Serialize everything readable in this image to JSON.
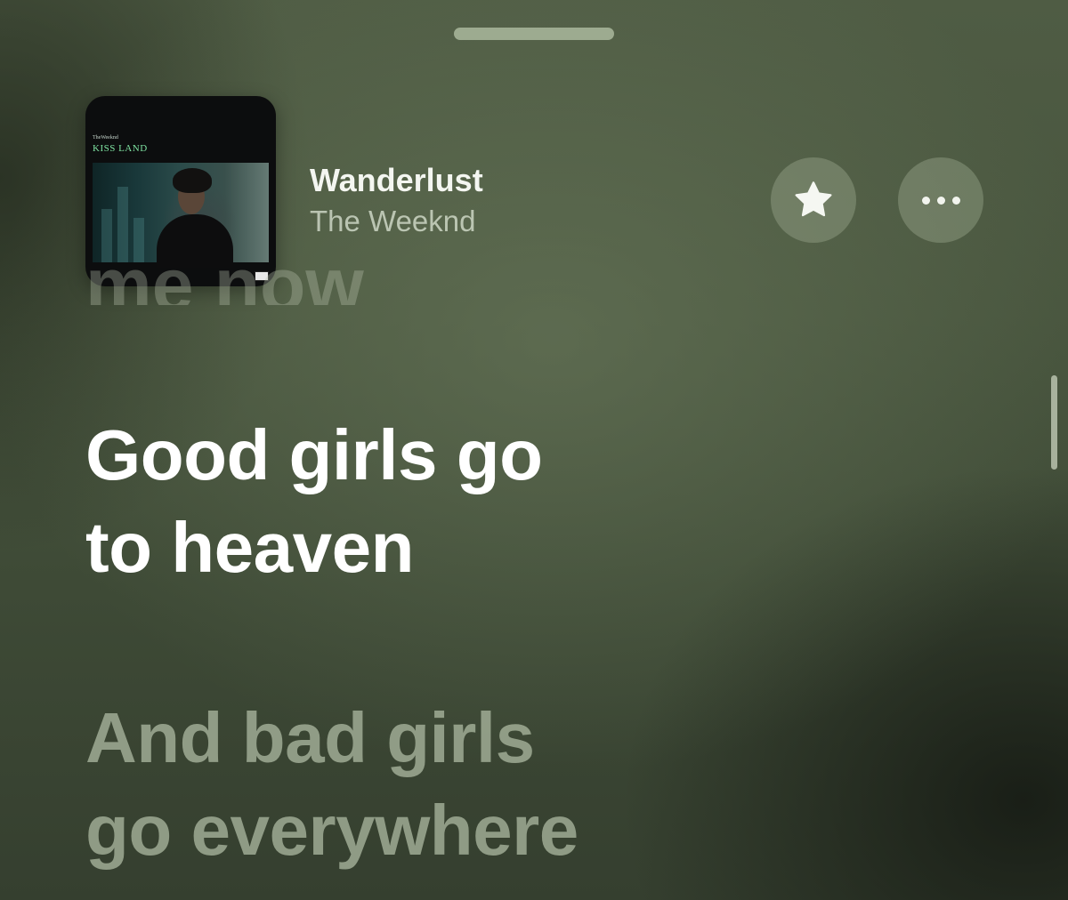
{
  "now_playing": {
    "album_art": {
      "brand_text": "TheWeeknd",
      "album_title": "KISS LAND",
      "title_color": "#7fe3a2"
    },
    "title": "Wanderlust",
    "artist": "The Weeknd",
    "favorite_icon": "star-icon",
    "more_icon": "ellipsis-icon"
  },
  "lyrics": {
    "previous_partial": "me now",
    "current": [
      "Good girls go",
      "to heaven"
    ],
    "next": [
      "And bad girls",
      "go everywhere"
    ]
  },
  "colors": {
    "background": "#48553e",
    "active_lyric": "#ffffff",
    "inactive_lyric": "#b2bea6"
  }
}
